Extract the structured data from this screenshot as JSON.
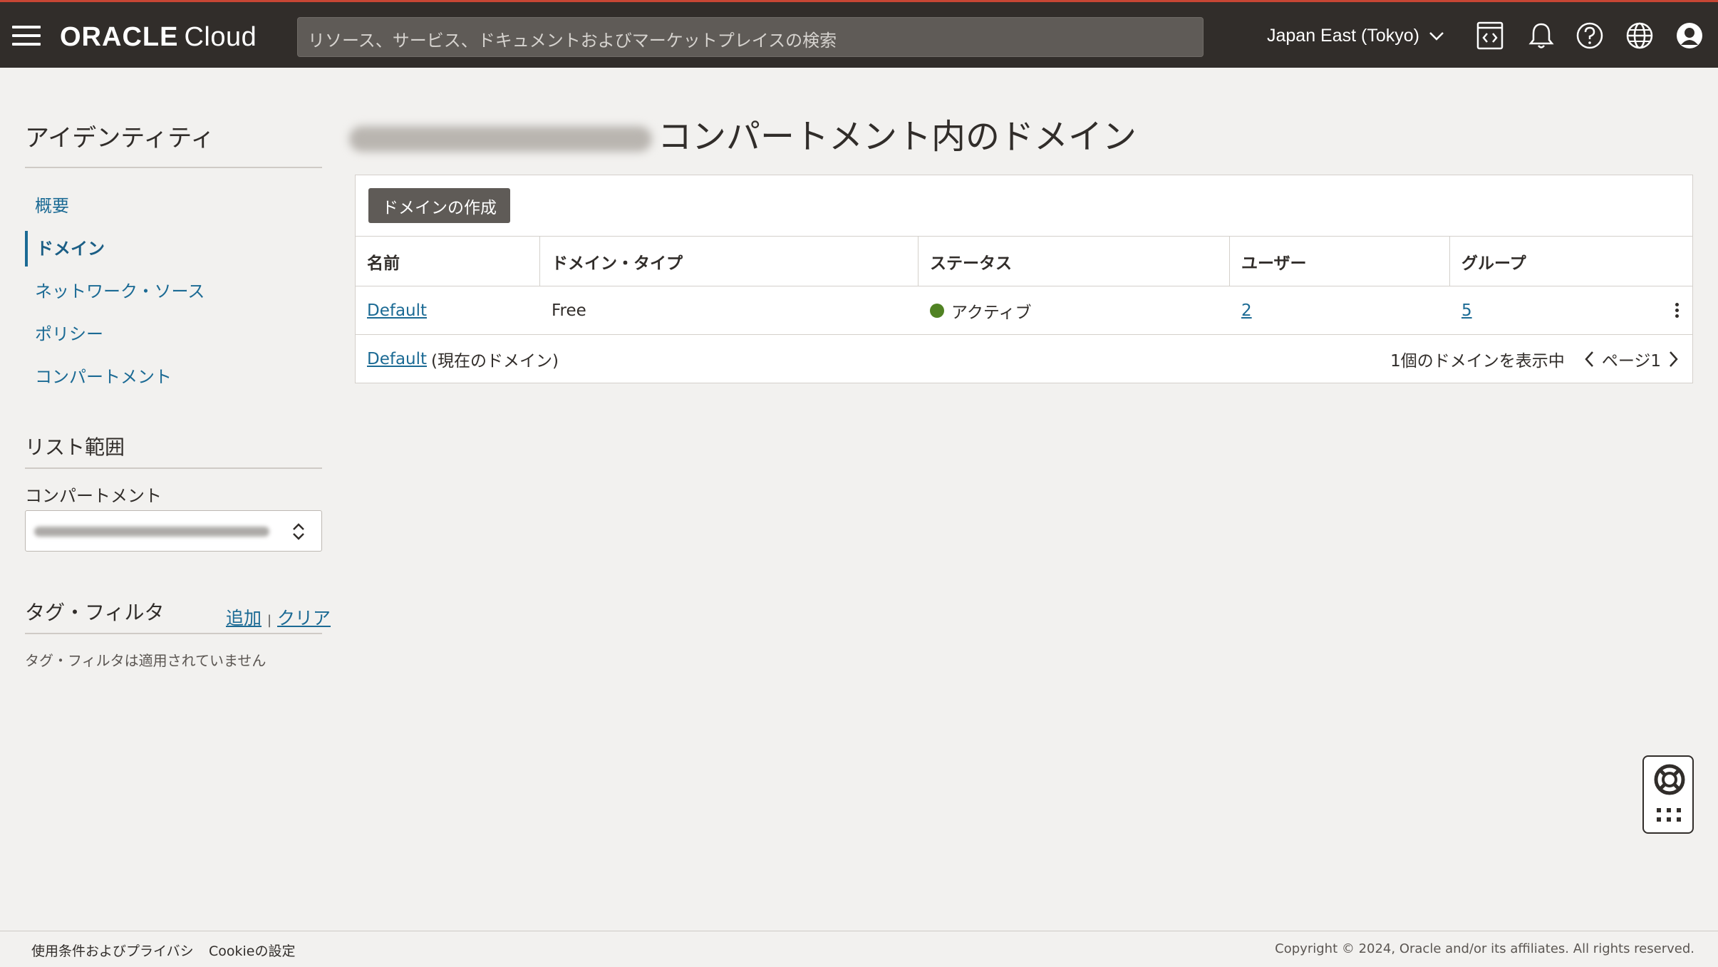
{
  "header": {
    "brand": "ORACLE",
    "product": "Cloud",
    "search_placeholder": "リソース、サービス、ドキュメントおよびマーケットプレイスの検索",
    "region": "Japan East (Tokyo)"
  },
  "sidebar": {
    "title": "アイデンティティ",
    "items": [
      {
        "label": "概要",
        "active": false
      },
      {
        "label": "ドメイン",
        "active": true
      },
      {
        "label": "ネットワーク・ソース",
        "active": false
      },
      {
        "label": "ポリシー",
        "active": false
      },
      {
        "label": "コンパートメント",
        "active": false
      }
    ],
    "list_scope": {
      "heading": "リスト範囲",
      "compartment_label": "コンパートメント"
    },
    "tag_filter": {
      "heading": "タグ・フィルタ",
      "add": "追加",
      "separator": "|",
      "clear": "クリア",
      "note": "タグ・フィルタは適用されていません"
    }
  },
  "main": {
    "title_suffix": "コンパートメント内のドメイン",
    "create_button": "ドメインの作成",
    "columns": [
      "名前",
      "ドメイン・タイプ",
      "ステータス",
      "ユーザー",
      "グループ"
    ],
    "rows": [
      {
        "name": "Default",
        "type": "Free",
        "status": "アクティブ",
        "users": "2",
        "groups": "5"
      }
    ],
    "footer": {
      "current_domain": "Default",
      "current_note": "(現在のドメイン)",
      "showing": "1個のドメインを表示中",
      "page": "ページ1"
    }
  },
  "footer": {
    "terms": "使用条件およびプライバシ",
    "cookies": "Cookieの設定",
    "copyright": "Copyright © 2024, Oracle and/or its affiliates. All rights reserved."
  },
  "colors": {
    "header_bg": "#312d2a",
    "accent_red": "#c74634",
    "link": "#1b6a94",
    "status_active": "#508223"
  }
}
